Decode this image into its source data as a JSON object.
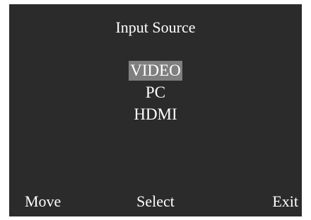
{
  "osd": {
    "title": "Input Source",
    "options": [
      {
        "label": "VIDEO",
        "selected": true
      },
      {
        "label": "PC",
        "selected": false
      },
      {
        "label": "HDMI",
        "selected": false
      }
    ],
    "footer": {
      "move_label": "Move",
      "select_label": "Select",
      "exit_label": "Exit"
    }
  },
  "colors": {
    "panel_background": "#2b2b2b",
    "highlight": "#7f7f7f",
    "text": "#ffffff"
  }
}
